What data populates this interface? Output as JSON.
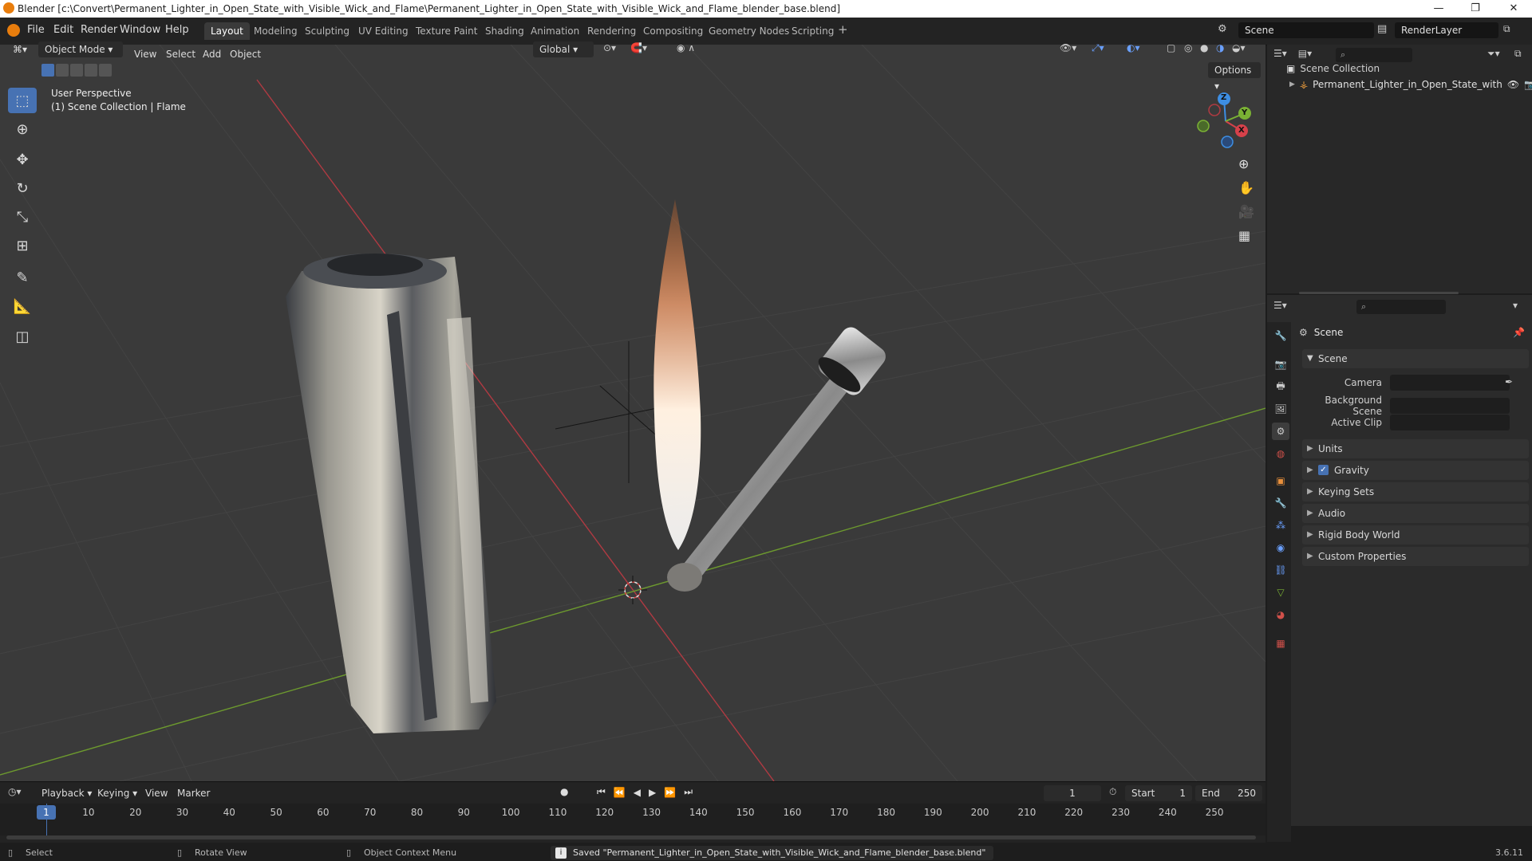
{
  "window": {
    "title": "Blender [c:\\Convert\\Permanent_Lighter_in_Open_State_with_Visible_Wick_and_Flame\\Permanent_Lighter_in_Open_State_with_Visible_Wick_and_Flame_blender_base.blend]",
    "minimize": "—",
    "restore": "❐",
    "close": "✕"
  },
  "menubar": {
    "items": [
      "File",
      "Edit",
      "Render",
      "Window",
      "Help"
    ]
  },
  "workspaces": {
    "tabs": [
      "Layout",
      "Modeling",
      "Sculpting",
      "UV Editing",
      "Texture Paint",
      "Shading",
      "Animation",
      "Rendering",
      "Compositing",
      "Geometry Nodes",
      "Scripting"
    ],
    "active": "Layout",
    "add": "+"
  },
  "scene_selector": {
    "value": "Scene"
  },
  "renderlayer_selector": {
    "value": "RenderLayer"
  },
  "viewport_header": {
    "mode": "Object Mode",
    "menus": [
      "View",
      "Select",
      "Add",
      "Object"
    ],
    "transform_orientation": "Global",
    "options": "Options"
  },
  "viewport": {
    "view_name": "User Perspective",
    "collection_info": "(1) Scene Collection | Flame",
    "gizmo_axes": [
      "X",
      "Y",
      "Z"
    ]
  },
  "outliner": {
    "root": "Scene Collection",
    "item": "Permanent_Lighter_in_Open_State_with"
  },
  "properties": {
    "header": "Scene",
    "section": "Scene",
    "fields": [
      {
        "label": "Camera"
      },
      {
        "label": "Background Scene"
      },
      {
        "label": "Active Clip"
      }
    ],
    "panels": [
      "Units",
      "Gravity",
      "Keying Sets",
      "Audio",
      "Rigid Body World",
      "Custom Properties"
    ],
    "gravity_checked": true
  },
  "timeline": {
    "menus": [
      "Playback",
      "Keying",
      "View",
      "Marker"
    ],
    "current_frame": "1",
    "start_label": "Start",
    "start": "1",
    "end_label": "End",
    "end": "250",
    "ticks": [
      "1",
      "10",
      "20",
      "30",
      "40",
      "50",
      "60",
      "70",
      "80",
      "90",
      "100",
      "110",
      "120",
      "130",
      "140",
      "150",
      "160",
      "170",
      "180",
      "190",
      "200",
      "210",
      "220",
      "230",
      "240",
      "250"
    ]
  },
  "statusbar": {
    "select": "Select",
    "rotate": "Rotate View",
    "context": "Object Context Menu",
    "message": "Saved \"Permanent_Lighter_in_Open_State_with_Visible_Wick_and_Flame_blender_base.blend\"",
    "version": "3.6.11"
  },
  "colors": {
    "accent": "#4772b3",
    "x_axis": "#d6414a",
    "y_axis": "#7ab134",
    "z_axis": "#3d8ee3"
  }
}
